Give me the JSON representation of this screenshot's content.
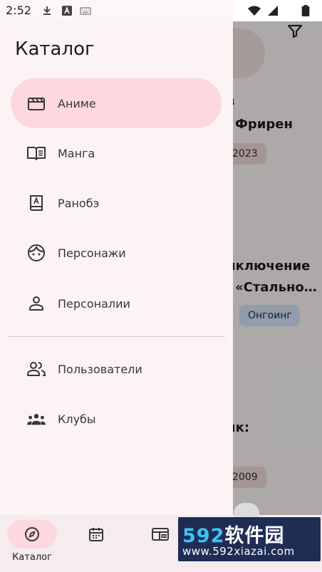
{
  "status_bar": {
    "time": "2:52"
  },
  "drawer": {
    "title": "Каталог",
    "items": [
      {
        "label": "Аниме",
        "icon": "clapperboard-icon",
        "active": true
      },
      {
        "label": "Манга",
        "icon": "open-book-icon"
      },
      {
        "label": "Ранобэ",
        "icon": "book-letter-icon"
      },
      {
        "label": "Персонажи",
        "icon": "face-icon"
      },
      {
        "label": "Персоналии",
        "icon": "person-icon"
      }
    ],
    "items2": [
      {
        "label": "Пользователи",
        "icon": "people-icon"
      },
      {
        "label": "Клубы",
        "icon": "groups-icon"
      }
    ]
  },
  "background": {
    "line1": "в",
    "line2": "Фрирен",
    "chip1": "2023",
    "line3": "иключение",
    "line4": "«Стально…",
    "chip2": "Онгоинг",
    "line5": "ик:",
    "chip3": "2009"
  },
  "bottom_nav": {
    "items": [
      {
        "label": "Каталог",
        "icon": "compass-icon",
        "active": true
      },
      {
        "label": "",
        "icon": "calendar-icon"
      },
      {
        "label": "",
        "icon": "news-icon"
      }
    ]
  },
  "watermark": {
    "brand_num": "592",
    "brand_text": "软件园",
    "url": "www.592xiazai.com"
  },
  "colors": {
    "accent": "#fdd8df",
    "drawer_bg": "#fcf4f4",
    "scrim": "rgba(0,0,0,0.32)",
    "chip_blue": "#d6e6ff"
  }
}
